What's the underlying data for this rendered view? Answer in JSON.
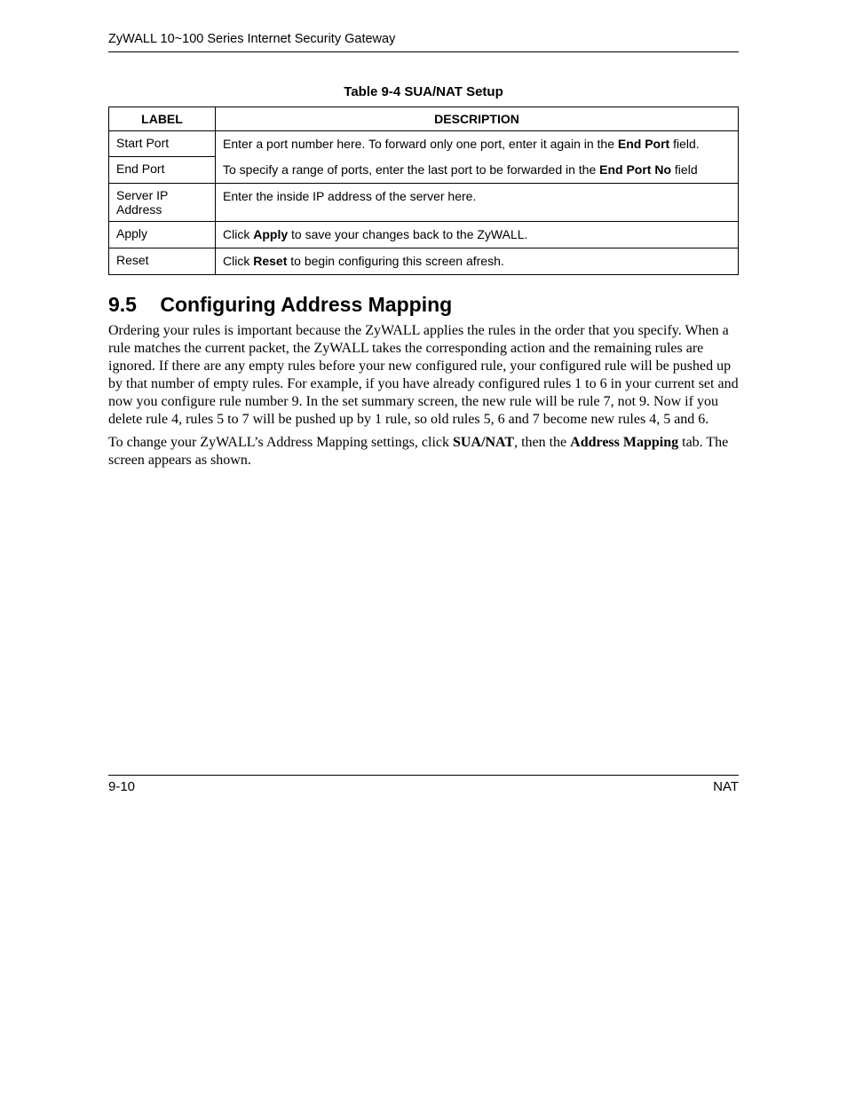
{
  "header": {
    "title": "ZyWALL 10~100 Series Internet Security Gateway"
  },
  "table": {
    "caption": "Table 9-4 SUA/NAT Setup",
    "columns": {
      "label": "LABEL",
      "description": "DESCRIPTION"
    },
    "rows": {
      "startPort": {
        "label": "Start Port",
        "desc_pre": "Enter a port number here. To forward only one port, enter it again in the ",
        "desc_bold": "End Port",
        "desc_post": " field."
      },
      "endPort": {
        "label": "End Port",
        "desc_pre": "To specify a range of ports, enter the last port to be forwarded in the ",
        "desc_bold": "End Port No",
        "desc_post": " field"
      },
      "serverIp": {
        "label": "Server IP Address",
        "desc": "Enter the inside IP address of the server here."
      },
      "apply": {
        "label": "Apply",
        "desc_pre": "Click ",
        "desc_bold": "Apply",
        "desc_post": " to save your changes back to the ZyWALL."
      },
      "reset": {
        "label": "Reset",
        "desc_pre": "Click ",
        "desc_bold": "Reset",
        "desc_post": " to begin configuring this screen afresh."
      }
    }
  },
  "section": {
    "number": "9.5",
    "title": "Configuring Address Mapping",
    "para1": "Ordering your rules is important because the ZyWALL applies the rules in the order that you specify. When a rule matches the current packet, the ZyWALL takes the corresponding action and the remaining rules are ignored. If there are any empty rules before your new configured rule, your configured rule will be pushed up by that number of empty rules. For example, if you have already configured rules 1 to 6 in your current set and now you configure rule number 9. In the set summary screen, the new rule will be rule 7, not 9. Now if you delete rule 4, rules 5 to 7 will be pushed up by 1 rule, so old rules 5, 6 and 7 become new rules 4, 5 and 6.",
    "para2_pre": "To change your ZyWALL’s Address Mapping settings, click ",
    "para2_b1": "SUA/NAT",
    "para2_mid": ", then the ",
    "para2_b2": "Address Mapping",
    "para2_post": " tab. The screen appears as shown."
  },
  "footer": {
    "left": "9-10",
    "right": "NAT"
  }
}
